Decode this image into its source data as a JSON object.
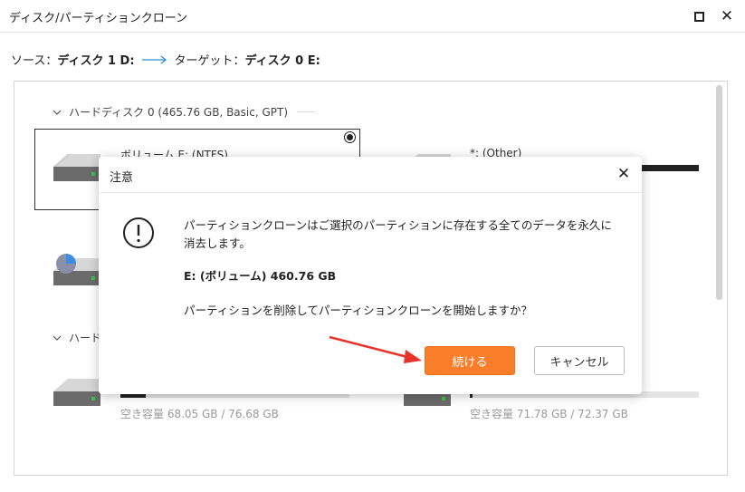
{
  "window": {
    "title": "ディスク/パーティションクローン"
  },
  "source_line": {
    "source_label": "ソース：",
    "source_value": "ディスク 1 D:",
    "target_label": "ターゲット：",
    "target_value": "ディスク 0 E:"
  },
  "disk0": {
    "header": "ハードディスク 0 (465.76 GB, Basic, GPT)",
    "partitions": [
      {
        "label": "ボリューム E: (NTFS)",
        "selected": true
      },
      {
        "label": "*: (Other)"
      }
    ]
  },
  "disk1": {
    "header": "ハード",
    "partitions": [
      {
        "space": "空き容量 68.05 GB / 76.68 GB",
        "fill": 0.11
      },
      {
        "space": "空き容量 71.78 GB / 72.37 GB",
        "fill": 0.01
      }
    ]
  },
  "dialog": {
    "title": "注意",
    "message": "パーティションクローンはご選択のパーティションに存在する全てのデータを永久に消去します。",
    "partition_info": "E: (ボリューム) 460.76 GB",
    "question": "パーティションを削除してパーティションクローンを開始しますか？",
    "continue_label": "続ける",
    "cancel_label": "キャンセル"
  },
  "colors": {
    "accent": "#fa7d2a",
    "arrow_blue": "#2a8ad6",
    "annotation_red": "#e8332a"
  }
}
